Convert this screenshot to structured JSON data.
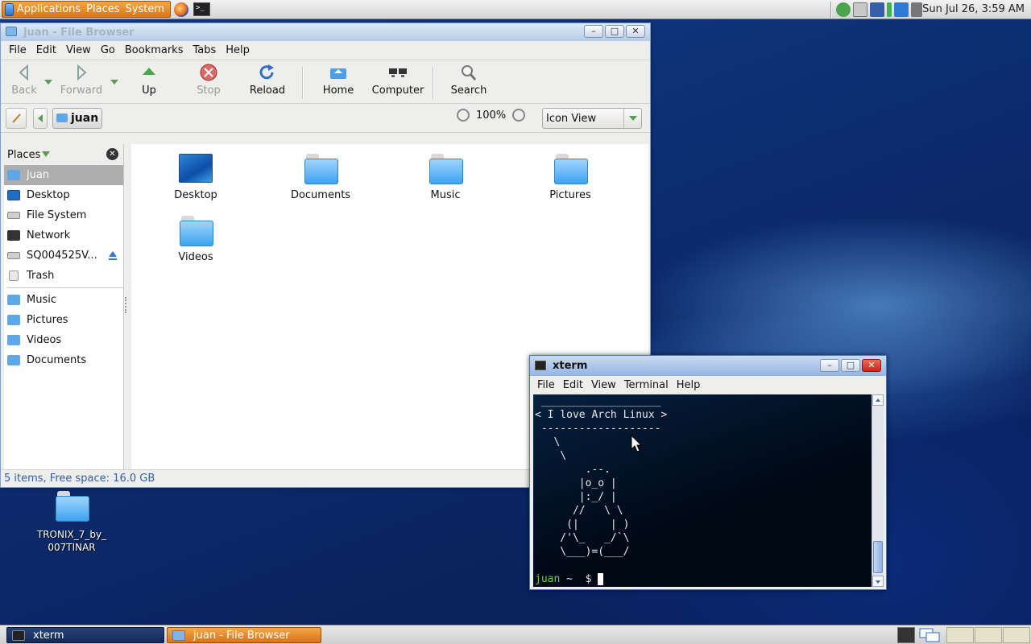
{
  "top_panel": {
    "menus": [
      "Applications",
      "Places",
      "System"
    ],
    "clock": "Sun Jul 26,  3:59 AM"
  },
  "desktop": {
    "icons": [
      {
        "label": "TRONIX_7_by_\n007TINAR"
      }
    ]
  },
  "file_browser": {
    "title": "juan - File Browser",
    "menu": [
      "File",
      "Edit",
      "View",
      "Go",
      "Bookmarks",
      "Tabs",
      "Help"
    ],
    "toolbar": {
      "back": "Back",
      "forward": "Forward",
      "up": "Up",
      "stop": "Stop",
      "reload": "Reload",
      "home": "Home",
      "computer": "Computer",
      "search": "Search"
    },
    "location": {
      "crumb": "juan",
      "zoom": "100%",
      "view_mode": "Icon View"
    },
    "sidebar": {
      "header": "Places",
      "places": [
        {
          "label": "juan",
          "icon": "home-folder-icon",
          "selected": true
        },
        {
          "label": "Desktop",
          "icon": "desktop-icon"
        },
        {
          "label": "File System",
          "icon": "drive-icon"
        },
        {
          "label": "Network",
          "icon": "network-icon"
        },
        {
          "label": "SQ004525V...",
          "icon": "drive-icon",
          "ejectable": true
        },
        {
          "label": "Trash",
          "icon": "trash-icon"
        }
      ],
      "bookmarks": [
        {
          "label": "Music"
        },
        {
          "label": "Pictures"
        },
        {
          "label": "Videos"
        },
        {
          "label": "Documents"
        }
      ]
    },
    "items": [
      {
        "label": "Desktop",
        "kind": "desktop"
      },
      {
        "label": "Documents",
        "kind": "folder"
      },
      {
        "label": "Music",
        "kind": "folder"
      },
      {
        "label": "Pictures",
        "kind": "folder"
      },
      {
        "label": "Videos",
        "kind": "folder"
      }
    ],
    "status": "5 items, Free space: 16.0 GB"
  },
  "xterm": {
    "title": "xterm",
    "menu": [
      "File",
      "Edit",
      "View",
      "Terminal",
      "Help"
    ],
    "output": " ___________________\n< I love Arch Linux >\n -------------------\n   \\\n    \\\n        .--.\n       |o_o |\n       |:_/ |\n      //   \\ \\\n     (|     | )\n    /'\\_   _/`\\\n    \\___)=(___/",
    "prompt_user": "juan",
    "prompt_rest": " ~  $ "
  },
  "taskbar": {
    "tasks": [
      "xterm",
      "juan - File Browser"
    ]
  },
  "colors": {
    "accent_orange": "#e08a2a",
    "status_text": "#2f5fa8",
    "prompt_green": "#6bcf3a"
  }
}
